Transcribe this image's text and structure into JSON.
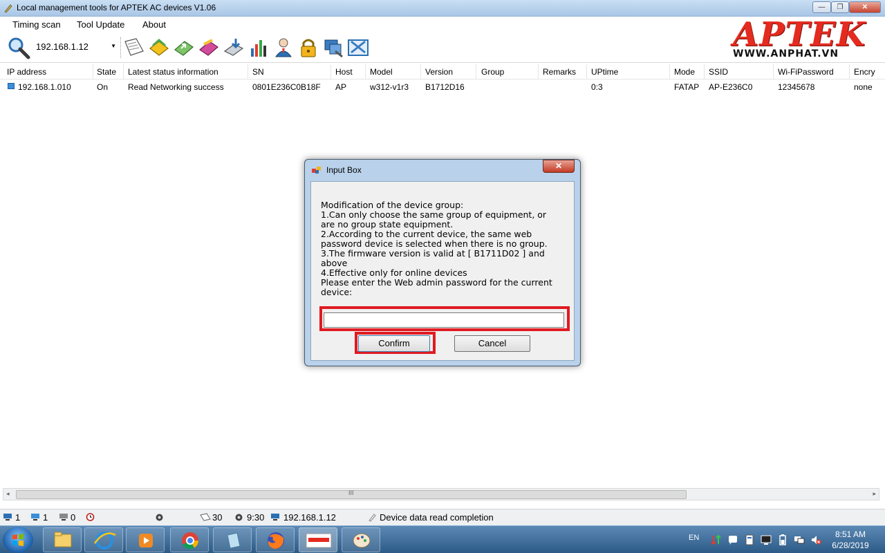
{
  "window": {
    "title": "Local management tools for APTEK AC devices  V1.06",
    "min": "—",
    "max": "❐",
    "close": "✕"
  },
  "menu": [
    "Timing scan",
    "Tool Update",
    "About"
  ],
  "toolbar": {
    "ip_value": "192.168.1.12"
  },
  "logo": {
    "brand": "APTEK",
    "url": "WWW.ANPHAT.VN",
    "color": "#e52a1f"
  },
  "table": {
    "headers": [
      "IP address",
      "State",
      "Latest status information",
      "SN",
      "Host",
      "Model",
      "Version",
      "Group",
      "Remarks",
      "UPtime",
      "Mode",
      "SSID",
      "Wi-FiPassword",
      "Encry"
    ],
    "rows": [
      [
        "192.168.1.010",
        "On",
        "Read Networking success",
        "0801E236C0B18F",
        "AP",
        "w312-v1r3",
        "B1712D16",
        "",
        "",
        "0:3",
        "FATAP",
        "AP-E236C0",
        "12345678",
        "none"
      ]
    ]
  },
  "scrollbar": {
    "grip": "III",
    "left": "◂",
    "right": "▸"
  },
  "status": {
    "count_total": "1",
    "count_online": "1",
    "count_offline": "0",
    "interval": "30",
    "time": "9:30",
    "ip": "192.168.1.12",
    "message": "Device data read completion"
  },
  "dialog": {
    "title": "Input Box",
    "close": "✕",
    "message_lines": [
      "Modification of the device group:",
      "1.Can only choose the same group of equipment, or",
      "are no group state equipment.",
      "2.According to the current device, the same web",
      "password device is selected when there is no group.",
      "3.The firmware version is valid at [ B1711D02 ] and",
      "above",
      "4.Effective only for online devices",
      "Please enter the Web admin password for the current",
      "device:"
    ],
    "password_value": "",
    "confirm_label": "Confirm",
    "cancel_label": "Cancel",
    "highlight_color": "#e01a22"
  },
  "taskbar": {
    "lang": "EN",
    "time": "8:51 AM",
    "date": "6/28/2019",
    "apps": [
      "file-explorer",
      "internet-explorer",
      "media-player",
      "chrome",
      "notepad",
      "firefox",
      "aptek-tool",
      "paint"
    ]
  }
}
